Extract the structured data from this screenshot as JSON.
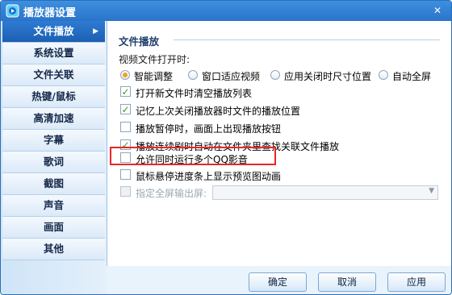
{
  "window": {
    "title": "播放器设置"
  },
  "sidebar": {
    "items": [
      {
        "label": "文件播放",
        "selected": true
      },
      {
        "label": "系统设置"
      },
      {
        "label": "文件关联"
      },
      {
        "label": "热键/鼠标"
      },
      {
        "label": "高清加速"
      },
      {
        "label": "字幕"
      },
      {
        "label": "歌词"
      },
      {
        "label": "截图"
      },
      {
        "label": "声音"
      },
      {
        "label": "画面"
      },
      {
        "label": "其他"
      }
    ]
  },
  "main": {
    "section_title": "文件播放",
    "open_mode_label": "视频文件打开时:",
    "radios": [
      {
        "label": "智能调整",
        "checked": true
      },
      {
        "label": "窗口适应视频",
        "checked": false
      },
      {
        "label": "应用关闭时尺寸位置",
        "checked": false
      },
      {
        "label": "自动全屏",
        "checked": false
      }
    ],
    "options": [
      {
        "label": "打开新文件时清空播放列表",
        "checked": true
      },
      {
        "label": "记忆上次关闭播放器时文件的播放位置",
        "checked": true
      },
      {
        "label": "播放暂停时，画面上出现播放按钮",
        "checked": false
      },
      {
        "label": "播放连续剧时自动在文件夹里查找关联文件播放",
        "checked": true
      },
      {
        "label": "允许同时运行多个QQ影音",
        "checked": false
      },
      {
        "label": "鼠标悬停进度条上显示预览图动画",
        "checked": false
      },
      {
        "label": "指定全屏输出屏:",
        "checked": false,
        "disabled": true
      }
    ],
    "fullscreen_select_value": ""
  },
  "footer": {
    "ok": "确定",
    "cancel": "取消",
    "apply": "应用"
  },
  "colors": {
    "accent": "#2a74c9",
    "highlight": "#e8262b",
    "check": "#3a9a27",
    "radio": "#f0a21c"
  }
}
